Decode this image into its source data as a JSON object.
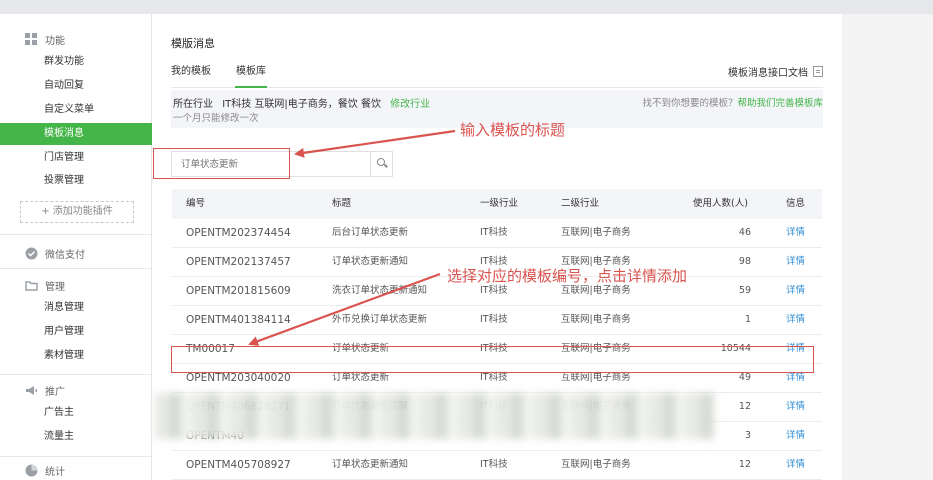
{
  "sidebar": {
    "sections": [
      {
        "title": "功能",
        "icon": "grid-icon"
      },
      {
        "title": "微信支付",
        "icon": "check-circle-icon"
      },
      {
        "title": "管理",
        "icon": "folder-icon"
      },
      {
        "title": "推广",
        "icon": "megaphone-icon"
      },
      {
        "title": "统计",
        "icon": "pie-chart-icon"
      }
    ],
    "function_items": [
      "群发功能",
      "自动回复",
      "自定义菜单",
      "模板消息",
      "门店管理",
      "投票管理"
    ],
    "active_item": "模板消息",
    "add_plugin": "+ 添加功能插件",
    "manage_items": [
      "消息管理",
      "用户管理",
      "素材管理"
    ],
    "promo_items": [
      "广告主",
      "流量主"
    ]
  },
  "main": {
    "title": "模版消息",
    "tabs": [
      {
        "label": "我的模板",
        "active": false
      },
      {
        "label": "模板库",
        "active": true
      }
    ],
    "doc_link": "模板消息接口文档",
    "industry": {
      "label": "所在行业",
      "value": "IT科技 互联网|电子商务，餐饮 餐饮",
      "modify": "修改行业",
      "note": "一个月只能修改一次",
      "help_text": "找不到你想要的模板？",
      "help_link": "帮助我们完善模板库"
    },
    "search": {
      "placeholder": "订单状态更新"
    },
    "table": {
      "headers": [
        "编号",
        "标题",
        "一级行业",
        "二级行业",
        "使用人数(人)",
        "信息"
      ],
      "rows": [
        {
          "code": "OPENTM202374454",
          "title": "后台订单状态更新",
          "ind1": "IT科技",
          "ind2": "互联网|电子商务",
          "users": "46",
          "action": "详情"
        },
        {
          "code": "OPENTM202137457",
          "title": "订单状态更新通知",
          "ind1": "IT科技",
          "ind2": "互联网|电子商务",
          "users": "98",
          "action": "详情"
        },
        {
          "code": "OPENTM201815609",
          "title": "洗衣订单状态更新通知",
          "ind1": "IT科技",
          "ind2": "互联网|电子商务",
          "users": "59",
          "action": "详情"
        },
        {
          "code": "OPENTM401384114",
          "title": "外币兑换订单状态更新",
          "ind1": "IT科技",
          "ind2": "互联网|电子商务",
          "users": "1",
          "action": "详情"
        },
        {
          "code": "TM00017",
          "title": "订单状态更新",
          "ind1": "IT科技",
          "ind2": "互联网|电子商务",
          "users": "10544",
          "action": "详情"
        },
        {
          "code": "OPENTM203040020",
          "title": "订单状态更新",
          "ind1": "IT科技",
          "ind2": "互联网|电子商务",
          "users": "49",
          "action": "详情"
        },
        {
          "code": "OPENTM406628271",
          "title": "订单状态更新提醒",
          "ind1": "IT科技",
          "ind2": "互联网|电子商务",
          "users": "12",
          "action": "详情"
        },
        {
          "code": "OPENTM40",
          "title": "",
          "ind1": "",
          "ind2": "",
          "users": "3",
          "action": "详情"
        },
        {
          "code": "OPENTM405708927",
          "title": "订单状态更新通知",
          "ind1": "IT科技",
          "ind2": "互联网|电子商务",
          "users": "12",
          "action": "详情"
        }
      ]
    }
  },
  "annotations": {
    "search_hint": "输入模板的标题",
    "select_hint": "选择对应的模板编号，点击详情添加"
  },
  "colors": {
    "accent": "#44b549",
    "link": "#2d8dd6",
    "annotation": "#d9534f"
  }
}
